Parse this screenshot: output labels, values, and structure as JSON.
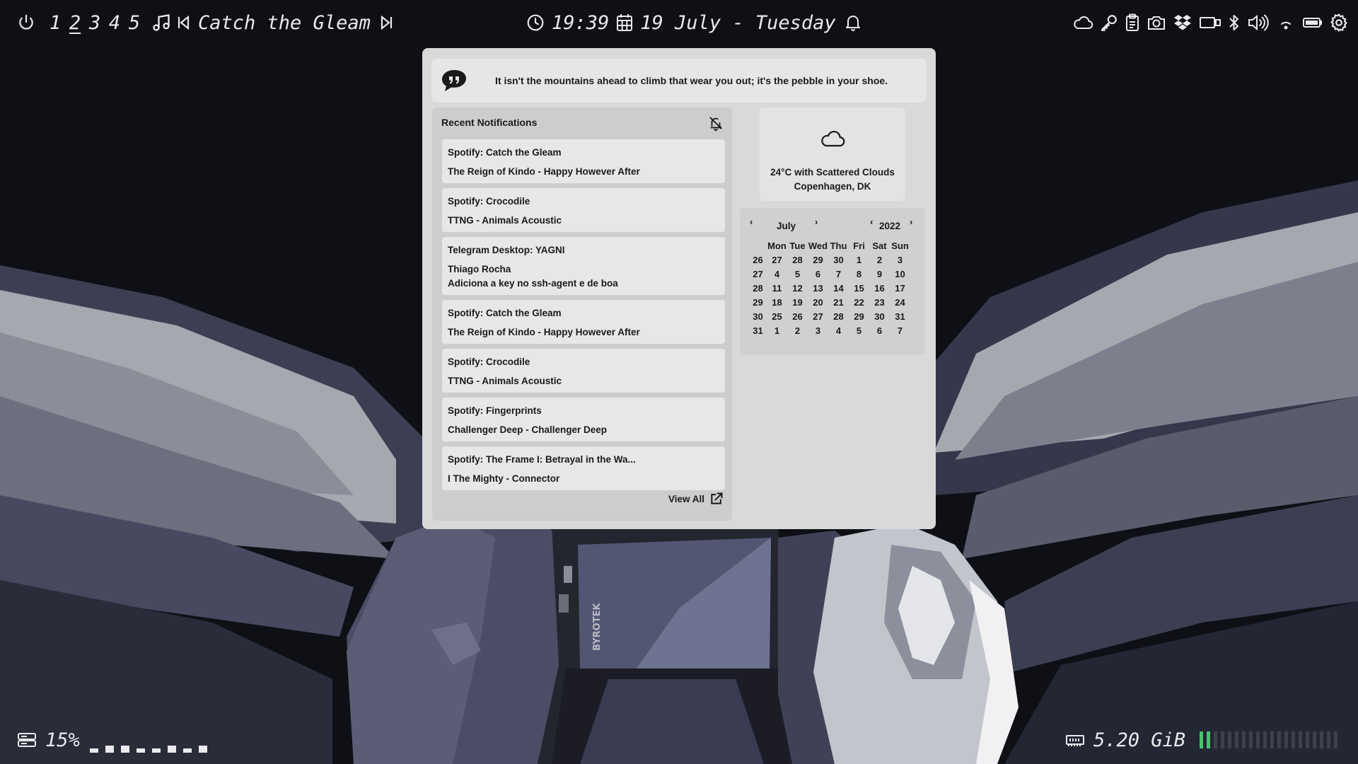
{
  "topbar": {
    "workspaces": [
      {
        "label": "1",
        "active": false
      },
      {
        "label": "2",
        "active": true
      },
      {
        "label": "3",
        "active": false
      },
      {
        "label": "4",
        "active": false
      },
      {
        "label": "5",
        "active": false
      }
    ],
    "now_playing": "Catch the Gleam",
    "time": "19:39",
    "date": "19 July - Tuesday",
    "tray_icons": [
      "cloud-icon",
      "key-icon",
      "clipboard-icon",
      "camera-icon",
      "dropbox-icon",
      "display-icon",
      "bluetooth-icon",
      "volume-icon",
      "wifi-icon",
      "battery-icon",
      "settings-icon"
    ]
  },
  "quote": {
    "text": "It isn't the mountains ahead to climb that wear you out; it's the pebble in your shoe."
  },
  "notifications": {
    "title": "Recent Notifications",
    "view_all_label": "View All",
    "items": [
      {
        "title": "Spotify: Catch the Gleam",
        "lines": [
          "The Reign of Kindo - Happy However After"
        ]
      },
      {
        "title": "Spotify: Crocodile",
        "lines": [
          "TTNG - Animals Acoustic"
        ]
      },
      {
        "title": "Telegram Desktop: YAGNI",
        "lines": [
          "Thiago Rocha",
          "Adiciona a key no ssh-agent e de boa"
        ]
      },
      {
        "title": "Spotify: Catch the Gleam",
        "lines": [
          "The Reign of Kindo - Happy However After"
        ]
      },
      {
        "title": "Spotify: Crocodile",
        "lines": [
          "TTNG - Animals Acoustic"
        ]
      },
      {
        "title": "Spotify: Fingerprints",
        "lines": [
          "Challenger Deep - Challenger Deep"
        ]
      },
      {
        "title": "Spotify: The Frame I: Betrayal in the Wa...",
        "lines": [
          "I The Mighty - Connector"
        ]
      },
      {
        "title": "",
        "lines": []
      }
    ]
  },
  "weather": {
    "description": "24°C with Scattered Clouds",
    "location": "Copenhagen, DK"
  },
  "calendar": {
    "month": "July",
    "year": "2022",
    "weekdays": [
      "Mon",
      "Tue",
      "Wed",
      "Thu",
      "Fri",
      "Sat",
      "Sun"
    ],
    "weeks": [
      {
        "week": "26",
        "days": [
          "27",
          "28",
          "29",
          "30",
          "1",
          "2",
          "3"
        ]
      },
      {
        "week": "27",
        "days": [
          "4",
          "5",
          "6",
          "7",
          "8",
          "9",
          "10"
        ]
      },
      {
        "week": "28",
        "days": [
          "11",
          "12",
          "13",
          "14",
          "15",
          "16",
          "17"
        ]
      },
      {
        "week": "29",
        "days": [
          "18",
          "19",
          "20",
          "21",
          "22",
          "23",
          "24"
        ]
      },
      {
        "week": "30",
        "days": [
          "25",
          "26",
          "27",
          "28",
          "29",
          "30",
          "31"
        ]
      },
      {
        "week": "31",
        "days": [
          "1",
          "2",
          "3",
          "4",
          "5",
          "6",
          "7"
        ]
      }
    ]
  },
  "bottombar": {
    "disk_percent": "15%",
    "memory": "5.20 GiB",
    "memory_fraction": 0.1
  },
  "colors": {
    "bar_text": "#e9e9ee",
    "memory_on": "#48c36a",
    "memory_off": "#3f4048",
    "popup_bg": "#d9d9d9"
  }
}
